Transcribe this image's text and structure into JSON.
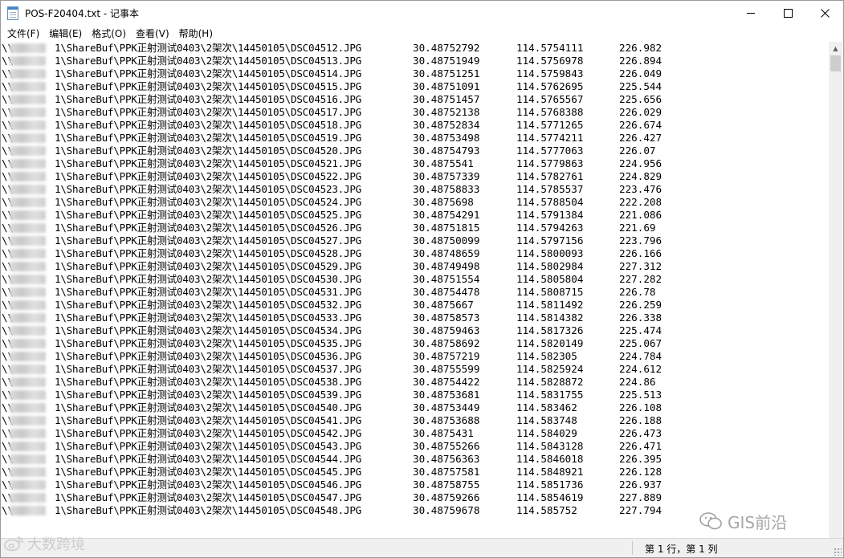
{
  "window": {
    "title": "POS-F20404.txt - 记事本"
  },
  "menu": [
    "文件(F)",
    "编辑(E)",
    "格式(O)",
    "查看(V)",
    "帮助(H)"
  ],
  "lines": [
    {
      "path": "\\\\       1\\ShareBuf\\PPK正射测试0403\\2架次\\14450105\\DSC04512.JPG",
      "lat": "30.48752792",
      "lon": "114.5754111",
      "alt": "226.982"
    },
    {
      "path": "\\\\       1\\ShareBuf\\PPK正射测试0403\\2架次\\14450105\\DSC04513.JPG",
      "lat": "30.48751949",
      "lon": "114.5756978",
      "alt": "226.894"
    },
    {
      "path": "\\\\       1\\ShareBuf\\PPK正射测试0403\\2架次\\14450105\\DSC04514.JPG",
      "lat": "30.48751251",
      "lon": "114.5759843",
      "alt": "226.049"
    },
    {
      "path": "\\\\       1\\ShareBuf\\PPK正射测试0403\\2架次\\14450105\\DSC04515.JPG",
      "lat": "30.48751091",
      "lon": "114.5762695",
      "alt": "225.544"
    },
    {
      "path": "\\\\       1\\ShareBuf\\PPK正射测试0403\\2架次\\14450105\\DSC04516.JPG",
      "lat": "30.48751457",
      "lon": "114.5765567",
      "alt": "225.656"
    },
    {
      "path": "\\\\       1\\ShareBuf\\PPK正射测试0403\\2架次\\14450105\\DSC04517.JPG",
      "lat": "30.48752138",
      "lon": "114.5768388",
      "alt": "226.029"
    },
    {
      "path": "\\\\       1\\ShareBuf\\PPK正射测试0403\\2架次\\14450105\\DSC04518.JPG",
      "lat": "30.48752834",
      "lon": "114.5771265",
      "alt": "226.674"
    },
    {
      "path": "\\\\       1\\ShareBuf\\PPK正射测试0403\\2架次\\14450105\\DSC04519.JPG",
      "lat": "30.48753498",
      "lon": "114.5774211",
      "alt": "226.427"
    },
    {
      "path": "\\\\       1\\ShareBuf\\PPK正射测试0403\\2架次\\14450105\\DSC04520.JPG",
      "lat": "30.48754793",
      "lon": "114.5777063",
      "alt": "226.07"
    },
    {
      "path": "\\\\       1\\ShareBuf\\PPK正射测试0403\\2架次\\14450105\\DSC04521.JPG",
      "lat": "30.4875541",
      "lon": "114.5779863",
      "alt": "224.956"
    },
    {
      "path": "\\\\       1\\ShareBuf\\PPK正射测试0403\\2架次\\14450105\\DSC04522.JPG",
      "lat": "30.48757339",
      "lon": "114.5782761",
      "alt": "224.829"
    },
    {
      "path": "\\\\       1\\ShareBuf\\PPK正射测试0403\\2架次\\14450105\\DSC04523.JPG",
      "lat": "30.48758833",
      "lon": "114.5785537",
      "alt": "223.476"
    },
    {
      "path": "\\\\       1\\ShareBuf\\PPK正射测试0403\\2架次\\14450105\\DSC04524.JPG",
      "lat": "30.4875698",
      "lon": "114.5788504",
      "alt": "222.208"
    },
    {
      "path": "\\\\       1\\ShareBuf\\PPK正射测试0403\\2架次\\14450105\\DSC04525.JPG",
      "lat": "30.48754291",
      "lon": "114.5791384",
      "alt": "221.086"
    },
    {
      "path": "\\\\       1\\ShareBuf\\PPK正射测试0403\\2架次\\14450105\\DSC04526.JPG",
      "lat": "30.48751815",
      "lon": "114.5794263",
      "alt": "221.69"
    },
    {
      "path": "\\\\       1\\ShareBuf\\PPK正射测试0403\\2架次\\14450105\\DSC04527.JPG",
      "lat": "30.48750099",
      "lon": "114.5797156",
      "alt": "223.796"
    },
    {
      "path": "\\\\       1\\ShareBuf\\PPK正射测试0403\\2架次\\14450105\\DSC04528.JPG",
      "lat": "30.48748659",
      "lon": "114.5800093",
      "alt": "226.166"
    },
    {
      "path": "\\\\       1\\ShareBuf\\PPK正射测试0403\\2架次\\14450105\\DSC04529.JPG",
      "lat": "30.48749498",
      "lon": "114.5802984",
      "alt": "227.312"
    },
    {
      "path": "\\\\       1\\ShareBuf\\PPK正射测试0403\\2架次\\14450105\\DSC04530.JPG",
      "lat": "30.48751554",
      "lon": "114.5805804",
      "alt": "227.282"
    },
    {
      "path": "\\\\       1\\ShareBuf\\PPK正射测试0403\\2架次\\14450105\\DSC04531.JPG",
      "lat": "30.48754478",
      "lon": "114.5808715",
      "alt": "226.78"
    },
    {
      "path": "\\\\       1\\ShareBuf\\PPK正射测试0403\\2架次\\14450105\\DSC04532.JPG",
      "lat": "30.4875667",
      "lon": "114.5811492",
      "alt": "226.259"
    },
    {
      "path": "\\\\       1\\ShareBuf\\PPK正射测试0403\\2架次\\14450105\\DSC04533.JPG",
      "lat": "30.48758573",
      "lon": "114.5814382",
      "alt": "226.338"
    },
    {
      "path": "\\\\       1\\ShareBuf\\PPK正射测试0403\\2架次\\14450105\\DSC04534.JPG",
      "lat": "30.48759463",
      "lon": "114.5817326",
      "alt": "225.474"
    },
    {
      "path": "\\\\       1\\ShareBuf\\PPK正射测试0403\\2架次\\14450105\\DSC04535.JPG",
      "lat": "30.48758692",
      "lon": "114.5820149",
      "alt": "225.067"
    },
    {
      "path": "\\\\       1\\ShareBuf\\PPK正射测试0403\\2架次\\14450105\\DSC04536.JPG",
      "lat": "30.48757219",
      "lon": "114.582305",
      "alt": "224.784"
    },
    {
      "path": "\\\\       1\\ShareBuf\\PPK正射测试0403\\2架次\\14450105\\DSC04537.JPG",
      "lat": "30.48755599",
      "lon": "114.5825924",
      "alt": "224.612"
    },
    {
      "path": "\\\\       1\\ShareBuf\\PPK正射测试0403\\2架次\\14450105\\DSC04538.JPG",
      "lat": "30.48754422",
      "lon": "114.5828872",
      "alt": "224.86"
    },
    {
      "path": "\\\\       1\\ShareBuf\\PPK正射测试0403\\2架次\\14450105\\DSC04539.JPG",
      "lat": "30.48753681",
      "lon": "114.5831755",
      "alt": "225.513"
    },
    {
      "path": "\\\\       1\\ShareBuf\\PPK正射测试0403\\2架次\\14450105\\DSC04540.JPG",
      "lat": "30.48753449",
      "lon": "114.583462",
      "alt": "226.108"
    },
    {
      "path": "\\\\       1\\ShareBuf\\PPK正射测试0403\\2架次\\14450105\\DSC04541.JPG",
      "lat": "30.48753688",
      "lon": "114.583748",
      "alt": "226.188"
    },
    {
      "path": "\\\\       1\\ShareBuf\\PPK正射测试0403\\2架次\\14450105\\DSC04542.JPG",
      "lat": "30.4875431",
      "lon": "114.584029",
      "alt": "226.473"
    },
    {
      "path": "\\\\       1\\ShareBuf\\PPK正射测试0403\\2架次\\14450105\\DSC04543.JPG",
      "lat": "30.48755266",
      "lon": "114.5843128",
      "alt": "226.471"
    },
    {
      "path": "\\\\       1\\ShareBuf\\PPK正射测试0403\\2架次\\14450105\\DSC04544.JPG",
      "lat": "30.48756363",
      "lon": "114.5846018",
      "alt": "226.395"
    },
    {
      "path": "\\\\       1\\ShareBuf\\PPK正射测试0403\\2架次\\14450105\\DSC04545.JPG",
      "lat": "30.48757581",
      "lon": "114.5848921",
      "alt": "226.128"
    },
    {
      "path": "\\\\       1\\ShareBuf\\PPK正射测试0403\\2架次\\14450105\\DSC04546.JPG",
      "lat": "30.48758755",
      "lon": "114.5851736",
      "alt": "226.937"
    },
    {
      "path": "\\\\       1\\ShareBuf\\PPK正射测试0403\\2架次\\14450105\\DSC04547.JPG",
      "lat": "30.48759266",
      "lon": "114.5854619",
      "alt": "227.889"
    },
    {
      "path": "\\\\       1\\ShareBuf\\PPK正射测试0403\\2架次\\14450105\\DSC04548.JPG",
      "lat": "30.48759678",
      "lon": "114.585752",
      "alt": "227.794"
    }
  ],
  "status": {
    "position": "第 1 行，第 1 列"
  },
  "watermarks": {
    "right": "GIS前沿",
    "left": "大数跨境"
  }
}
